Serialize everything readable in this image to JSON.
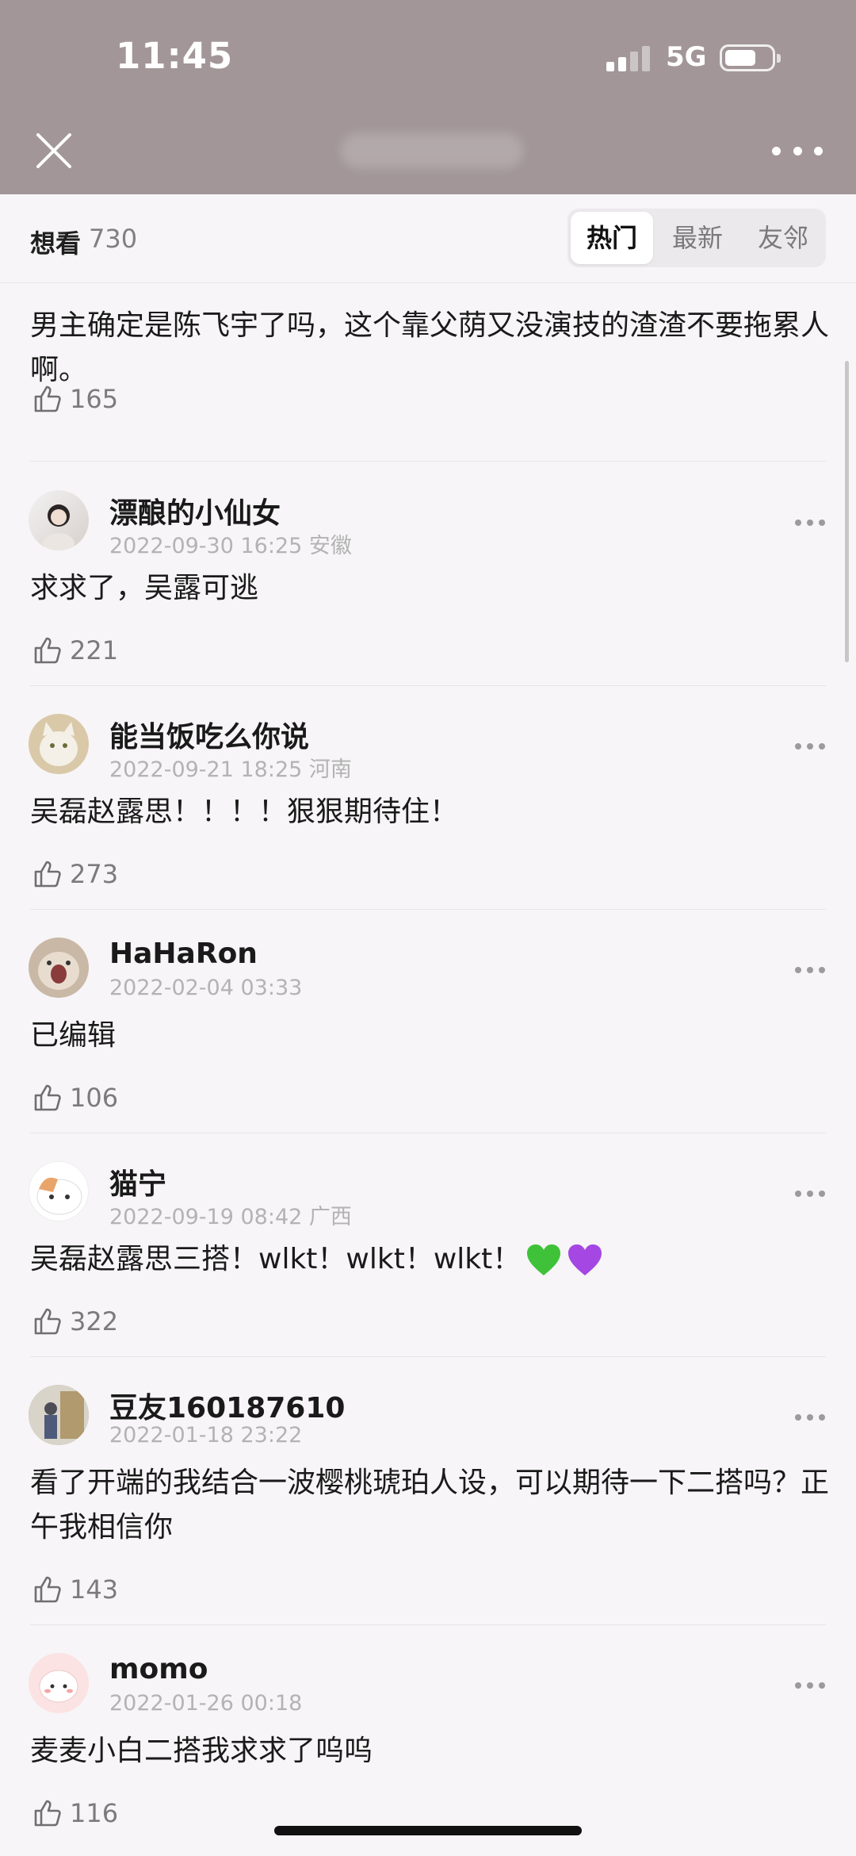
{
  "status_bar": {
    "time": "11:45",
    "network": "5G"
  },
  "header": {
    "close_icon": "close-icon",
    "more_icon": "more-horizontal-icon"
  },
  "subbar": {
    "want_label": "想看",
    "want_count": "730",
    "tabs": [
      {
        "label": "热门",
        "active": true
      },
      {
        "label": "最新",
        "active": false
      },
      {
        "label": "友邻",
        "active": false
      }
    ]
  },
  "comments": [
    {
      "partial": true,
      "text": "男主确定是陈飞宇了吗，这个靠父荫又没演技的渣渣不要拖累人啊。",
      "likes": "165"
    },
    {
      "name": "漂酿的小仙女",
      "date": "2022-09-30 16:25",
      "location": "安徽",
      "text": "求求了，吴露可逃",
      "likes": "221"
    },
    {
      "name": "能当饭吃么你说",
      "date": "2022-09-21 18:25",
      "location": "河南",
      "text": "吴磊赵露思！！！！狠狠期待住！",
      "likes": "273"
    },
    {
      "name": "HaHaRon",
      "date": "2022-02-04 03:33",
      "location": "",
      "text": "已编辑",
      "likes": "106"
    },
    {
      "name": "猫宁",
      "date": "2022-09-19 08:42",
      "location": "广西",
      "text": "吴磊赵露思三搭！wlkt！wlkt！wlkt！",
      "emojis": [
        "💚",
        "💜"
      ],
      "likes": "322"
    },
    {
      "name": "豆友160187610",
      "date": "2022-01-18 23:22",
      "location": "",
      "text": "看了开端的我结合一波樱桃琥珀人设，可以期待一下二搭吗？正午我相信你",
      "likes": "143"
    },
    {
      "name": "momo",
      "date": "2022-01-26 00:18",
      "location": "",
      "text": "麦麦小白二搭我求求了呜呜",
      "likes": "116"
    }
  ],
  "colors": {
    "header_bg": "#a29698",
    "page_bg": "#f7f5f7",
    "green_heart": "#3fc23a",
    "purple_heart": "#a447e3"
  }
}
